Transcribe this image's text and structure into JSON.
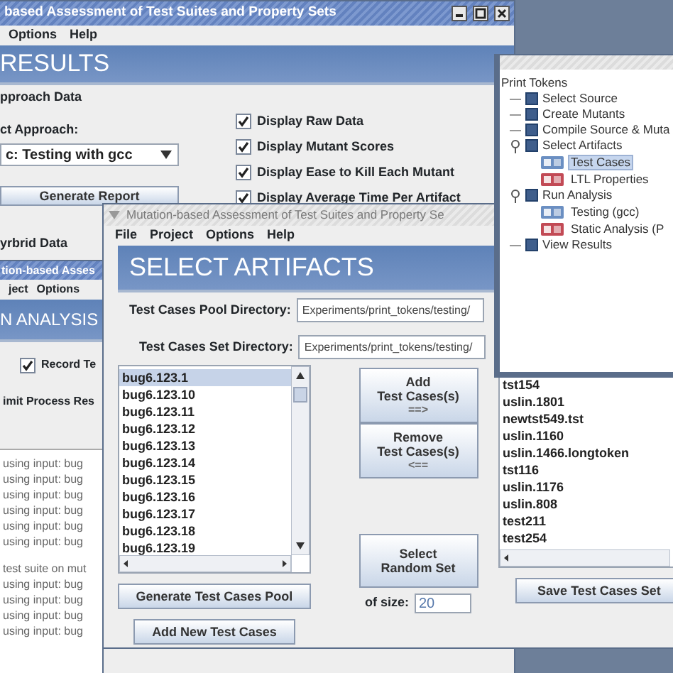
{
  "results_window": {
    "title": "based Assessment of Test Suites and Property Sets",
    "menu": [
      "Options",
      "Help"
    ],
    "banner": "RESULTS",
    "group_label": "pproach Data",
    "approach_label": "ct Approach:",
    "approach_value": "c: Testing with gcc",
    "generate_button": "Generate Report",
    "options": [
      {
        "label": "Display Raw Data",
        "checked": true
      },
      {
        "label": "Display Mutant Scores",
        "checked": true
      },
      {
        "label": "Display Ease to Kill Each Mutant",
        "checked": true
      },
      {
        "label": "Display Average Time Per Artifact",
        "checked": true
      }
    ],
    "next_group_label": "yrbrid Data"
  },
  "analysis_window": {
    "title": "tion-based Asses",
    "menu": [
      "ject",
      "Options"
    ],
    "banner": "N ANALYSIS",
    "record_option": {
      "label": "Record Te",
      "checked": true
    },
    "limit_label": "imit Process Res",
    "log_blocks": [
      [
        "using input: bug",
        "using input: bug",
        "using input: bug",
        "using input: bug",
        "using input: bug",
        "using input: bug"
      ],
      [
        "test suite on mut",
        "using input: bug",
        "using input: bug",
        "using input: bug",
        "using input: bug"
      ]
    ]
  },
  "artifacts_window": {
    "title": "Mutation-based Assessment of Test Suites and Property Se",
    "menu": [
      "File",
      "Project",
      "Options",
      "Help"
    ],
    "banner": "SELECT ARTIFACTS",
    "pool_dir": {
      "label": "Test Cases Pool Directory:",
      "value": "Experiments/print_tokens/testing/"
    },
    "set_dir": {
      "label": "Test Cases Set Directory:",
      "value": "Experiments/print_tokens/testing/"
    },
    "pool_list": [
      {
        "text": "bug6.123.1",
        "selected": true
      },
      {
        "text": "bug6.123.10",
        "selected": false
      },
      {
        "text": "bug6.123.11",
        "selected": false
      },
      {
        "text": "bug6.123.12",
        "selected": false
      },
      {
        "text": "bug6.123.13",
        "selected": false
      },
      {
        "text": "bug6.123.14",
        "selected": false
      },
      {
        "text": "bug6.123.15",
        "selected": false
      },
      {
        "text": "bug6.123.16",
        "selected": false
      },
      {
        "text": "bug6.123.17",
        "selected": false
      },
      {
        "text": "bug6.123.18",
        "selected": false
      },
      {
        "text": "bug6.123.19",
        "selected": false
      }
    ],
    "add_button": [
      "Add",
      "Test Cases(s)",
      "==>"
    ],
    "remove_button": [
      "Remove",
      "Test Cases(s)",
      "<=="
    ],
    "random_button": [
      "Select",
      "Random Set"
    ],
    "size_label": "of size:",
    "size_value": "20",
    "generate_pool_button": "Generate Test Cases Pool",
    "add_new_button": "Add New Test Cases",
    "set_list": [
      "tst154",
      "uslin.1801",
      "newtst549.tst",
      "uslin.1160",
      "uslin.1466.longtoken",
      "tst116",
      "uslin.1176",
      "uslin.808",
      "test211",
      "test254"
    ],
    "save_button": "Save Test Cases Set"
  },
  "tree_window": {
    "root": "Print Tokens",
    "items": [
      {
        "label": "Select Source"
      },
      {
        "label": "Create Mutants"
      },
      {
        "label": "Compile Source & Muta"
      },
      {
        "label": "Select Artifacts",
        "expanded": true,
        "children": [
          {
            "label": "Test Cases",
            "kind": "test",
            "selected": true
          },
          {
            "label": "LTL Properties",
            "kind": "property",
            "selected": false
          }
        ]
      },
      {
        "label": "Run Analysis",
        "expanded": true,
        "children": [
          {
            "label": "Testing (gcc)",
            "kind": "test",
            "selected": false
          },
          {
            "label": "Static Analysis (P",
            "kind": "property",
            "selected": false
          }
        ]
      },
      {
        "label": "View Results"
      }
    ]
  }
}
